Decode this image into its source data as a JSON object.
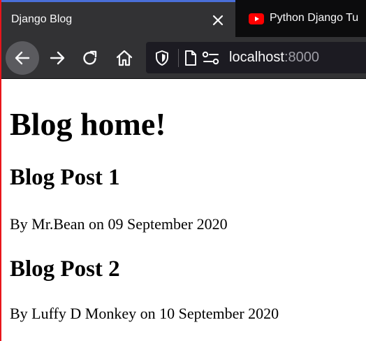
{
  "browser": {
    "tabs": [
      {
        "title": "Django Blog",
        "active": true
      },
      {
        "title": "Python Django Tu",
        "active": false,
        "icon": "youtube-icon"
      }
    ],
    "toolbar": {
      "url_host": "localhost",
      "url_port": ":8000"
    },
    "colors": {
      "tab_strip": "#0c0c0d",
      "active_tab": "#323234",
      "accent": "#4a6fd8",
      "frame_border": "#e8151b"
    }
  },
  "page": {
    "heading": "Blog home!",
    "posts": [
      {
        "title": "Blog Post 1",
        "meta": "By Mr.Bean on 09 September 2020"
      },
      {
        "title": "Blog Post 2",
        "meta": "By Luffy D Monkey on 10 September 2020"
      }
    ]
  }
}
